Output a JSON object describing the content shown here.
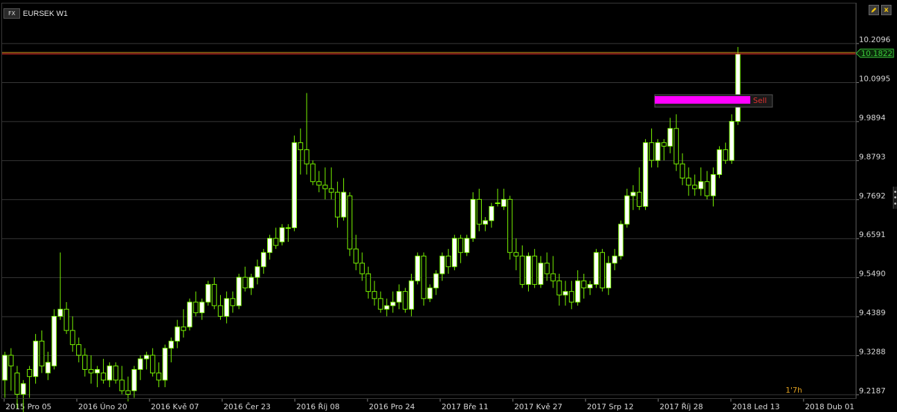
{
  "header": {
    "badge": "FX",
    "symbol": "EURSEK W1"
  },
  "buttons": {
    "edit_icon": "pencil-icon",
    "close_icon": "close-icon",
    "close_label": "x"
  },
  "colors": {
    "bull": "#ffffff",
    "bull_outline": "#7CFC00",
    "bear": "#000000",
    "wick": "#7CFC00",
    "grid": "#3a3a3a",
    "axis_text": "#d8d8d8",
    "price_line": "#ff3030",
    "price_line2": "#e0a020",
    "price_label": "#3ccc3c",
    "order_bar": "#ff00ff"
  },
  "timer": "1'7h",
  "chart_data": {
    "type": "candlestick",
    "title": "EURSEK W1",
    "ylim": [
      9.2187,
      10.2096
    ],
    "y_ticks": [
      "10.2096",
      "10.0995",
      "9.9894",
      "9.8793",
      "9.7692",
      "9.6591",
      "9.5490",
      "9.4389",
      "9.3288",
      "9.2187"
    ],
    "x_ticks": [
      "2015 Pro 05",
      "2016 Úno 20",
      "2016 Kvě 07",
      "2016 Čer 23",
      "2016 Říj 08",
      "2016 Pro 24",
      "2017 Bře 11",
      "2017 Kvě 27",
      "2017 Srp 12",
      "2017 Říj 28",
      "2018 Led 13",
      "2018 Dub 01"
    ],
    "current_price": "10.1822",
    "order_label": "Sell",
    "grid": true,
    "ohlc": [
      [
        9.26,
        9.34,
        9.21,
        9.33
      ],
      [
        9.33,
        9.35,
        9.23,
        9.3
      ],
      [
        9.28,
        9.3,
        9.18,
        9.22
      ],
      [
        9.22,
        9.26,
        9.17,
        9.25
      ],
      [
        9.29,
        9.3,
        9.21,
        9.27
      ],
      [
        9.27,
        9.39,
        9.25,
        9.37
      ],
      [
        9.37,
        9.4,
        9.28,
        9.3
      ],
      [
        9.28,
        9.34,
        9.26,
        9.31
      ],
      [
        9.3,
        9.46,
        9.29,
        9.44
      ],
      [
        9.44,
        9.62,
        9.43,
        9.46
      ],
      [
        9.46,
        9.48,
        9.39,
        9.4
      ],
      [
        9.4,
        9.44,
        9.34,
        9.36
      ],
      [
        9.36,
        9.38,
        9.31,
        9.33
      ],
      [
        9.33,
        9.35,
        9.27,
        9.29
      ],
      [
        9.29,
        9.33,
        9.25,
        9.28
      ],
      [
        9.28,
        9.3,
        9.24,
        9.29
      ],
      [
        9.28,
        9.32,
        9.25,
        9.26
      ],
      [
        9.26,
        9.31,
        9.24,
        9.3
      ],
      [
        9.3,
        9.31,
        9.25,
        9.26
      ],
      [
        9.26,
        9.3,
        9.22,
        9.23
      ],
      [
        9.23,
        9.27,
        9.2,
        9.22
      ],
      [
        9.23,
        9.3,
        9.21,
        9.29
      ],
      [
        9.29,
        9.33,
        9.26,
        9.32
      ],
      [
        9.32,
        9.34,
        9.29,
        9.33
      ],
      [
        9.33,
        9.35,
        9.27,
        9.28
      ],
      [
        9.28,
        9.31,
        9.24,
        9.26
      ],
      [
        9.26,
        9.36,
        9.24,
        9.35
      ],
      [
        9.35,
        9.38,
        9.31,
        9.37
      ],
      [
        9.37,
        9.43,
        9.35,
        9.41
      ],
      [
        9.41,
        9.46,
        9.38,
        9.4
      ],
      [
        9.41,
        9.49,
        9.4,
        9.48
      ],
      [
        9.48,
        9.51,
        9.44,
        9.45
      ],
      [
        9.45,
        9.49,
        9.43,
        9.48
      ],
      [
        9.48,
        9.54,
        9.47,
        9.53
      ],
      [
        9.53,
        9.55,
        9.46,
        9.47
      ],
      [
        9.47,
        9.5,
        9.43,
        9.44
      ],
      [
        9.44,
        9.51,
        9.42,
        9.49
      ],
      [
        9.49,
        9.51,
        9.45,
        9.47
      ],
      [
        9.47,
        9.56,
        9.46,
        9.55
      ],
      [
        9.55,
        9.58,
        9.51,
        9.52
      ],
      [
        9.52,
        9.56,
        9.5,
        9.55
      ],
      [
        9.55,
        9.6,
        9.53,
        9.58
      ],
      [
        9.58,
        9.63,
        9.56,
        9.62
      ],
      [
        9.62,
        9.67,
        9.6,
        9.66
      ],
      [
        9.66,
        9.69,
        9.63,
        9.64
      ],
      [
        9.65,
        9.7,
        9.64,
        9.69
      ],
      [
        9.69,
        9.7,
        9.65,
        9.69
      ],
      [
        9.69,
        9.95,
        9.68,
        9.93
      ],
      [
        9.93,
        9.97,
        9.84,
        9.91
      ],
      [
        9.91,
        10.07,
        9.84,
        9.87
      ],
      [
        9.87,
        9.88,
        9.81,
        9.82
      ],
      [
        9.82,
        9.85,
        9.79,
        9.81
      ],
      [
        9.81,
        9.86,
        9.77,
        9.8
      ],
      [
        9.8,
        9.86,
        9.77,
        9.79
      ],
      [
        9.79,
        9.82,
        9.69,
        9.72
      ],
      [
        9.72,
        9.83,
        9.71,
        9.79
      ],
      [
        9.78,
        9.79,
        9.61,
        9.63
      ],
      [
        9.63,
        9.67,
        9.57,
        9.59
      ],
      [
        9.59,
        9.62,
        9.54,
        9.56
      ],
      [
        9.56,
        9.58,
        9.49,
        9.51
      ],
      [
        9.51,
        9.54,
        9.47,
        9.49
      ],
      [
        9.49,
        9.51,
        9.45,
        9.46
      ],
      [
        9.46,
        9.49,
        9.44,
        9.47
      ],
      [
        9.47,
        9.51,
        9.45,
        9.48
      ],
      [
        9.48,
        9.53,
        9.46,
        9.51
      ],
      [
        9.51,
        9.52,
        9.45,
        9.46
      ],
      [
        9.46,
        9.56,
        9.44,
        9.54
      ],
      [
        9.54,
        9.62,
        9.53,
        9.61
      ],
      [
        9.61,
        9.62,
        9.47,
        9.49
      ],
      [
        9.49,
        9.53,
        9.48,
        9.52
      ],
      [
        9.52,
        9.57,
        9.5,
        9.56
      ],
      [
        9.56,
        9.62,
        9.54,
        9.61
      ],
      [
        9.61,
        9.63,
        9.56,
        9.58
      ],
      [
        9.58,
        9.67,
        9.57,
        9.66
      ],
      [
        9.66,
        9.67,
        9.59,
        9.62
      ],
      [
        9.62,
        9.67,
        9.61,
        9.66
      ],
      [
        9.66,
        9.79,
        9.65,
        9.77
      ],
      [
        9.77,
        9.8,
        9.68,
        9.7
      ],
      [
        9.7,
        9.72,
        9.68,
        9.71
      ],
      [
        9.71,
        9.76,
        9.69,
        9.75
      ],
      [
        9.76,
        9.8,
        9.75,
        9.76
      ],
      [
        9.75,
        9.8,
        9.74,
        9.77
      ],
      [
        9.77,
        9.78,
        9.6,
        9.62
      ],
      [
        9.62,
        9.66,
        9.57,
        9.61
      ],
      [
        9.61,
        9.64,
        9.52,
        9.53
      ],
      [
        9.53,
        9.62,
        9.51,
        9.61
      ],
      [
        9.61,
        9.63,
        9.52,
        9.53
      ],
      [
        9.53,
        9.61,
        9.52,
        9.59
      ],
      [
        9.59,
        9.62,
        9.54,
        9.56
      ],
      [
        9.56,
        9.61,
        9.52,
        9.54
      ],
      [
        9.54,
        9.56,
        9.47,
        9.5
      ],
      [
        9.5,
        9.54,
        9.47,
        9.51
      ],
      [
        9.51,
        9.54,
        9.46,
        9.48
      ],
      [
        9.48,
        9.57,
        9.47,
        9.54
      ],
      [
        9.54,
        9.56,
        9.49,
        9.52
      ],
      [
        9.52,
        9.54,
        9.5,
        9.53
      ],
      [
        9.53,
        9.63,
        9.52,
        9.62
      ],
      [
        9.62,
        9.63,
        9.51,
        9.52
      ],
      [
        9.52,
        9.61,
        9.5,
        9.59
      ],
      [
        9.59,
        9.63,
        9.57,
        9.61
      ],
      [
        9.61,
        9.71,
        9.6,
        9.7
      ],
      [
        9.7,
        9.8,
        9.69,
        9.78
      ],
      [
        9.78,
        9.81,
        9.74,
        9.79
      ],
      [
        9.79,
        9.86,
        9.74,
        9.75
      ],
      [
        9.75,
        9.94,
        9.74,
        9.93
      ],
      [
        9.93,
        9.97,
        9.86,
        9.88
      ],
      [
        9.88,
        9.94,
        9.86,
        9.93
      ],
      [
        9.93,
        9.94,
        9.88,
        9.92
      ],
      [
        9.92,
        10.0,
        9.9,
        9.97
      ],
      [
        9.97,
        10.01,
        9.85,
        9.87
      ],
      [
        9.87,
        9.9,
        9.81,
        9.83
      ],
      [
        9.83,
        9.86,
        9.78,
        9.81
      ],
      [
        9.81,
        9.84,
        9.78,
        9.8
      ],
      [
        9.8,
        9.86,
        9.78,
        9.82
      ],
      [
        9.82,
        9.85,
        9.77,
        9.78
      ],
      [
        9.78,
        9.86,
        9.75,
        9.84
      ],
      [
        9.84,
        9.92,
        9.83,
        9.91
      ],
      [
        9.91,
        9.93,
        9.87,
        9.88
      ],
      [
        9.88,
        10.01,
        9.87,
        9.99
      ],
      [
        9.99,
        10.2,
        9.98,
        10.18
      ]
    ]
  }
}
